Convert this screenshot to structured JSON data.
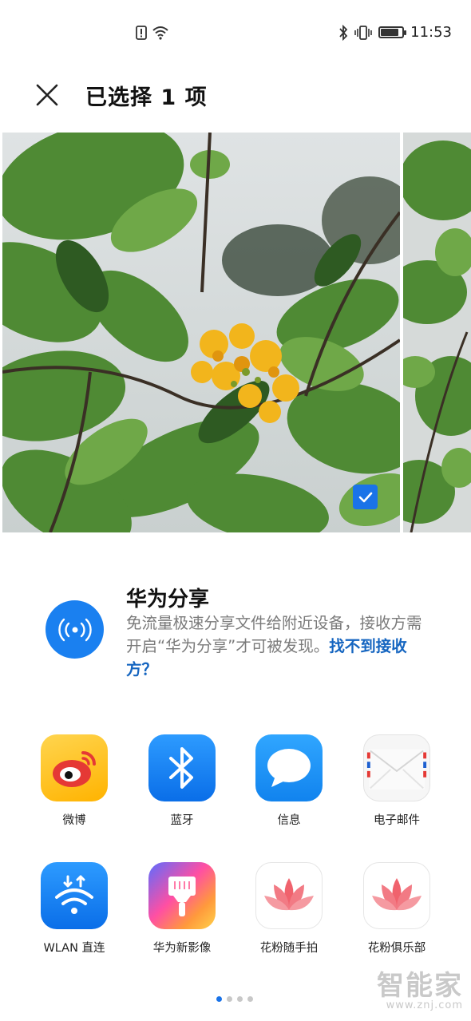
{
  "status_bar": {
    "time": "11:53",
    "battery_level": 0.85,
    "icons": [
      "alert-icon",
      "wifi-icon",
      "bluetooth-icon",
      "vibrate-icon",
      "battery-icon"
    ]
  },
  "header": {
    "title": "已选择 1 项"
  },
  "photos": {
    "selected_count": 1,
    "checked": true
  },
  "huawei_share": {
    "title": "华为分享",
    "description": "免流量极速分享文件给附近设备，接收方需开启“华为分享”才可被发现。",
    "link": "找不到接收方？",
    "icon": "nearby-share-icon",
    "accent": "#1a80f0"
  },
  "apps": [
    {
      "label": "微博",
      "icon": "weibo-icon"
    },
    {
      "label": "蓝牙",
      "icon": "bluetooth-icon"
    },
    {
      "label": "信息",
      "icon": "messages-icon"
    },
    {
      "label": "电子邮件",
      "icon": "email-icon"
    },
    {
      "label": "WLAN 直连",
      "icon": "wlan-direct-icon"
    },
    {
      "label": "华为新影像",
      "icon": "huawei-imaging-icon"
    },
    {
      "label": "花粉随手拍",
      "icon": "lotus-icon"
    },
    {
      "label": "花粉俱乐部",
      "icon": "lotus-icon"
    }
  ],
  "pager": {
    "pages": 4,
    "current": 1
  },
  "watermark": {
    "main": "智能家",
    "sub": "www.znj.com"
  }
}
